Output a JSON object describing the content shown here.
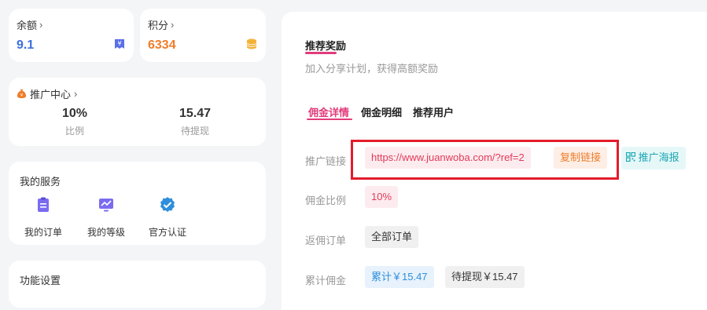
{
  "balance": {
    "label": "余额",
    "value": "9.1",
    "icon": "yen-ticket-icon",
    "color": "#3b6fe0"
  },
  "points": {
    "label": "积分",
    "value": "6334",
    "icon": "coin-stack-icon",
    "color": "#ef7d2b"
  },
  "promo": {
    "title": "推广中心",
    "icon": "money-bag-icon",
    "stats": [
      {
        "value": "10%",
        "label": "比例"
      },
      {
        "value": "15.47",
        "label": "待提现"
      }
    ]
  },
  "services": {
    "title": "我的服务",
    "items": [
      {
        "label": "我的订单",
        "icon": "clipboard-icon",
        "color": "#7b6bf0"
      },
      {
        "label": "我的等级",
        "icon": "monitor-chart-icon",
        "color": "#7b6bf0"
      },
      {
        "label": "官方认证",
        "icon": "verified-badge-icon",
        "color": "#2f8fdc"
      }
    ]
  },
  "functions": {
    "title": "功能设置"
  },
  "main": {
    "title": "推荐奖励",
    "subtitle": "加入分享计划，获得高额奖励",
    "tabs": [
      {
        "label": "佣金详情",
        "active": true
      },
      {
        "label": "佣金明细",
        "active": false
      },
      {
        "label": "推荐用户",
        "active": false
      }
    ],
    "link_label": "推广链接",
    "link_value": "https://www.juanwoba.com/?ref=2",
    "copy_label": "复制链接",
    "poster_label": "推广海报",
    "poster_icon": "qr-code-icon",
    "rate_label": "佣金比例",
    "rate_value": "10%",
    "orders_label": "返佣订单",
    "orders_value": "全部订单",
    "total_label": "累计佣金",
    "total_value": "累计￥15.47",
    "pending_value": "待提现￥15.47"
  }
}
